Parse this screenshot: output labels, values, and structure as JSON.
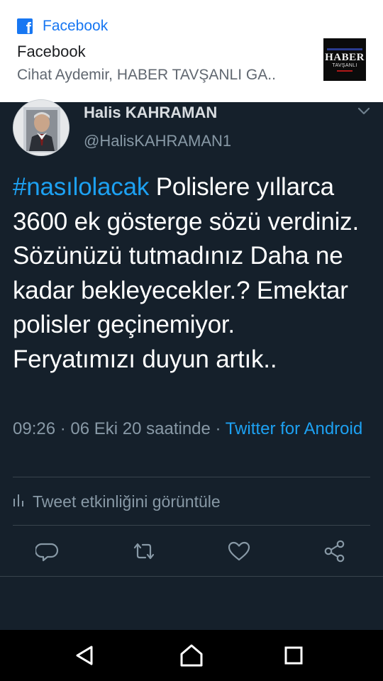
{
  "share_card": {
    "source_label": "Facebook",
    "title": "Facebook",
    "description": "Cihat Aydemir, HABER TAVŞANLI GA..",
    "thumbnail_text": "HABER",
    "thumbnail_subtext": "TAVŞANLI",
    "brand_color": "#1877f2"
  },
  "tweet": {
    "author_name": "Halis KAHRAMAN",
    "author_handle": "@HalisKAHRAMAN1",
    "hashtag": "#nasılolacak",
    "body": " Polislere yıllarca 3600 ek gösterge sözü verdiniz. Sözünüzü tutmadınız Daha ne kadar bekleyecekler.? Emektar polisler geçinemiyor. Feryatımızı duyun artık..",
    "timestamp": "09:26 · 06 Eki 20 saatinde · ",
    "client": "Twitter for Android",
    "activity_label": "Tweet etkinliğini görüntüle",
    "accent_color": "#1da1f2",
    "background_color": "#15202b"
  },
  "actions": {
    "icons": [
      "reply-icon",
      "retweet-icon",
      "like-icon",
      "share-icon"
    ]
  },
  "navbar": {
    "icons": [
      "back-icon",
      "home-icon",
      "recents-icon"
    ]
  }
}
